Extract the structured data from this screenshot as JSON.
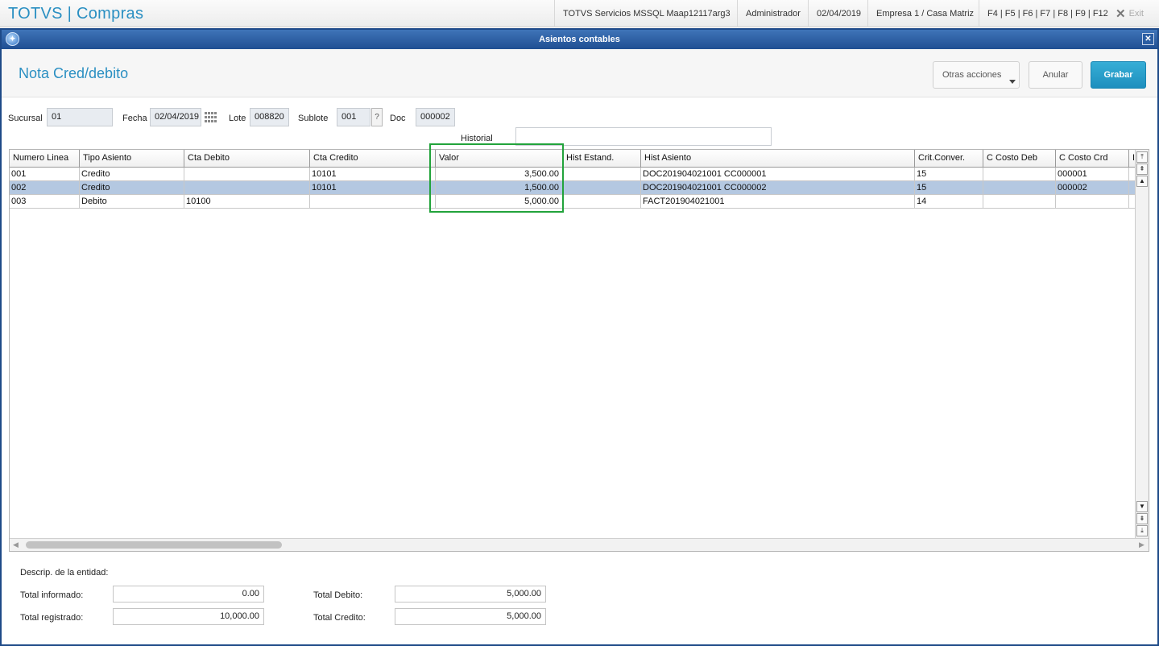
{
  "app": {
    "title": "TOTVS | Compras",
    "environment": "TOTVS Servicios MSSQL Maap12117arg3",
    "user": "Administrador",
    "date": "02/04/2019",
    "company": "Empresa 1 / Casa Matriz",
    "shortcuts": "F4 | F5 | F6 | F7 | F8 | F9 | F12",
    "exit_label": "Exit"
  },
  "dialog": {
    "title": "Asientos contables",
    "page_title": "Nota Cred/debito",
    "buttons": {
      "otras": "Otras acciones",
      "anular": "Anular",
      "grabar": "Grabar"
    }
  },
  "form": {
    "sucursal_label": "Sucursal",
    "sucursal_value": "01",
    "fecha_label": "Fecha",
    "fecha_value": "02/04/2019",
    "lote_label": "Lote",
    "lote_value": "008820",
    "sublote_label": "Sublote",
    "sublote_value": "001",
    "help_label": "?",
    "doc_label": "Doc",
    "doc_value": "000002",
    "historial_label": "Historial",
    "historial_value": ""
  },
  "grid": {
    "columns": [
      "Numero Linea",
      "Tipo Asiento",
      "Cta Debito",
      "Cta Credito",
      "Valor",
      "Hist Estand.",
      "Hist Asiento",
      "Crit.Conver.",
      "C Costo Deb",
      "C Costo Crd",
      "I"
    ],
    "rows": [
      {
        "linea": "001",
        "tipo": "Credito",
        "debito": "",
        "credito": "10101",
        "valor": "3,500.00",
        "estand": "",
        "hist": "DOC201904021001 CC000001",
        "crit": "15",
        "ccdeb": "",
        "cccrd": "000001",
        "selected": false
      },
      {
        "linea": "002",
        "tipo": "Credito",
        "debito": "",
        "credito": "10101",
        "valor": "1,500.00",
        "estand": "",
        "hist": "DOC201904021001 CC000002",
        "crit": "15",
        "ccdeb": "",
        "cccrd": "000002",
        "selected": true
      },
      {
        "linea": "003",
        "tipo": "Debito",
        "debito": "10100",
        "credito": "",
        "valor": "5,000.00",
        "estand": "",
        "hist": "FACT201904021001",
        "crit": "14",
        "ccdeb": "",
        "cccrd": "",
        "selected": false
      }
    ],
    "selected_row_color": "#b4c8e1",
    "highlight_color": "#22a33b"
  },
  "footer": {
    "descrip_label": "Descrip. de la entidad:",
    "total_informado_label": "Total informado:",
    "total_informado": "0.00",
    "total_registrado_label": "Total registrado:",
    "total_registrado": "10,000.00",
    "total_debito_label": "Total Debito:",
    "total_debito": "5,000.00",
    "total_credito_label": "Total Credito:",
    "total_credito": "5,000.00"
  },
  "colors": {
    "accent": "#2a8fc2",
    "titlebar": "#1f4f92",
    "primary_button": "#1e8fbe"
  }
}
